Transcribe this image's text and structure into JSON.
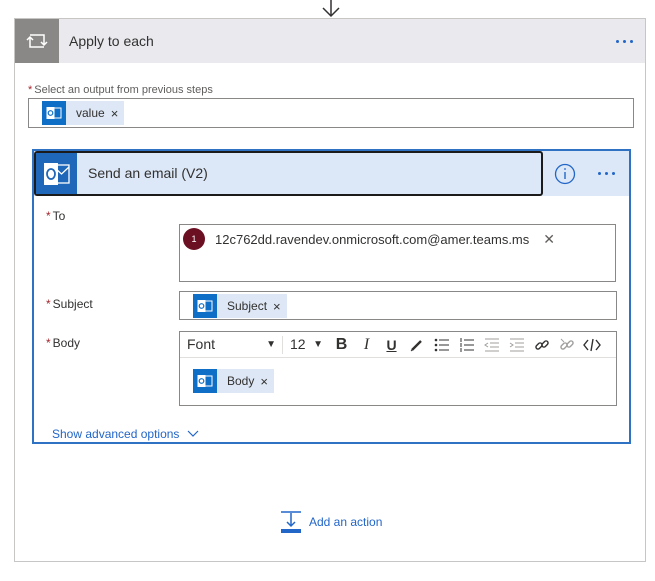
{
  "loop": {
    "title": "Apply to each",
    "select_label": "Select an output from previous steps",
    "required_mark": "*",
    "token": {
      "label": "value",
      "remove": "×"
    }
  },
  "action": {
    "title": "Send an email (V2)",
    "fields": {
      "to": {
        "label": "To",
        "required_mark": "*",
        "recipient": {
          "avatar": "1",
          "address": "12c762dd.ravendev.onmicrosoft.com@amer.teams.ms",
          "remove": "✕"
        }
      },
      "subject": {
        "label": "Subject",
        "required_mark": "*",
        "token": {
          "label": "Subject",
          "remove": "×"
        }
      },
      "body": {
        "label": "Body",
        "required_mark": "*",
        "toolbar": {
          "font": "Font",
          "size": "12"
        },
        "token": {
          "label": "Body",
          "remove": "×"
        }
      }
    },
    "show_advanced": "Show advanced options"
  },
  "add_action": "Add an action",
  "colors": {
    "accent": "#2266c8",
    "outlook_blue": "#0f6fc6",
    "loop_gray": "#8a8886",
    "avatar": "#6b0f22",
    "required": "#a4262c"
  },
  "icons": {
    "top_arrow": "arrow-down-icon",
    "loop": "loop-icon",
    "outlook": "outlook-icon",
    "info": "info-icon",
    "more": "more-icon",
    "chevron": "chevron-down-icon",
    "add_action": "add-action-icon"
  }
}
